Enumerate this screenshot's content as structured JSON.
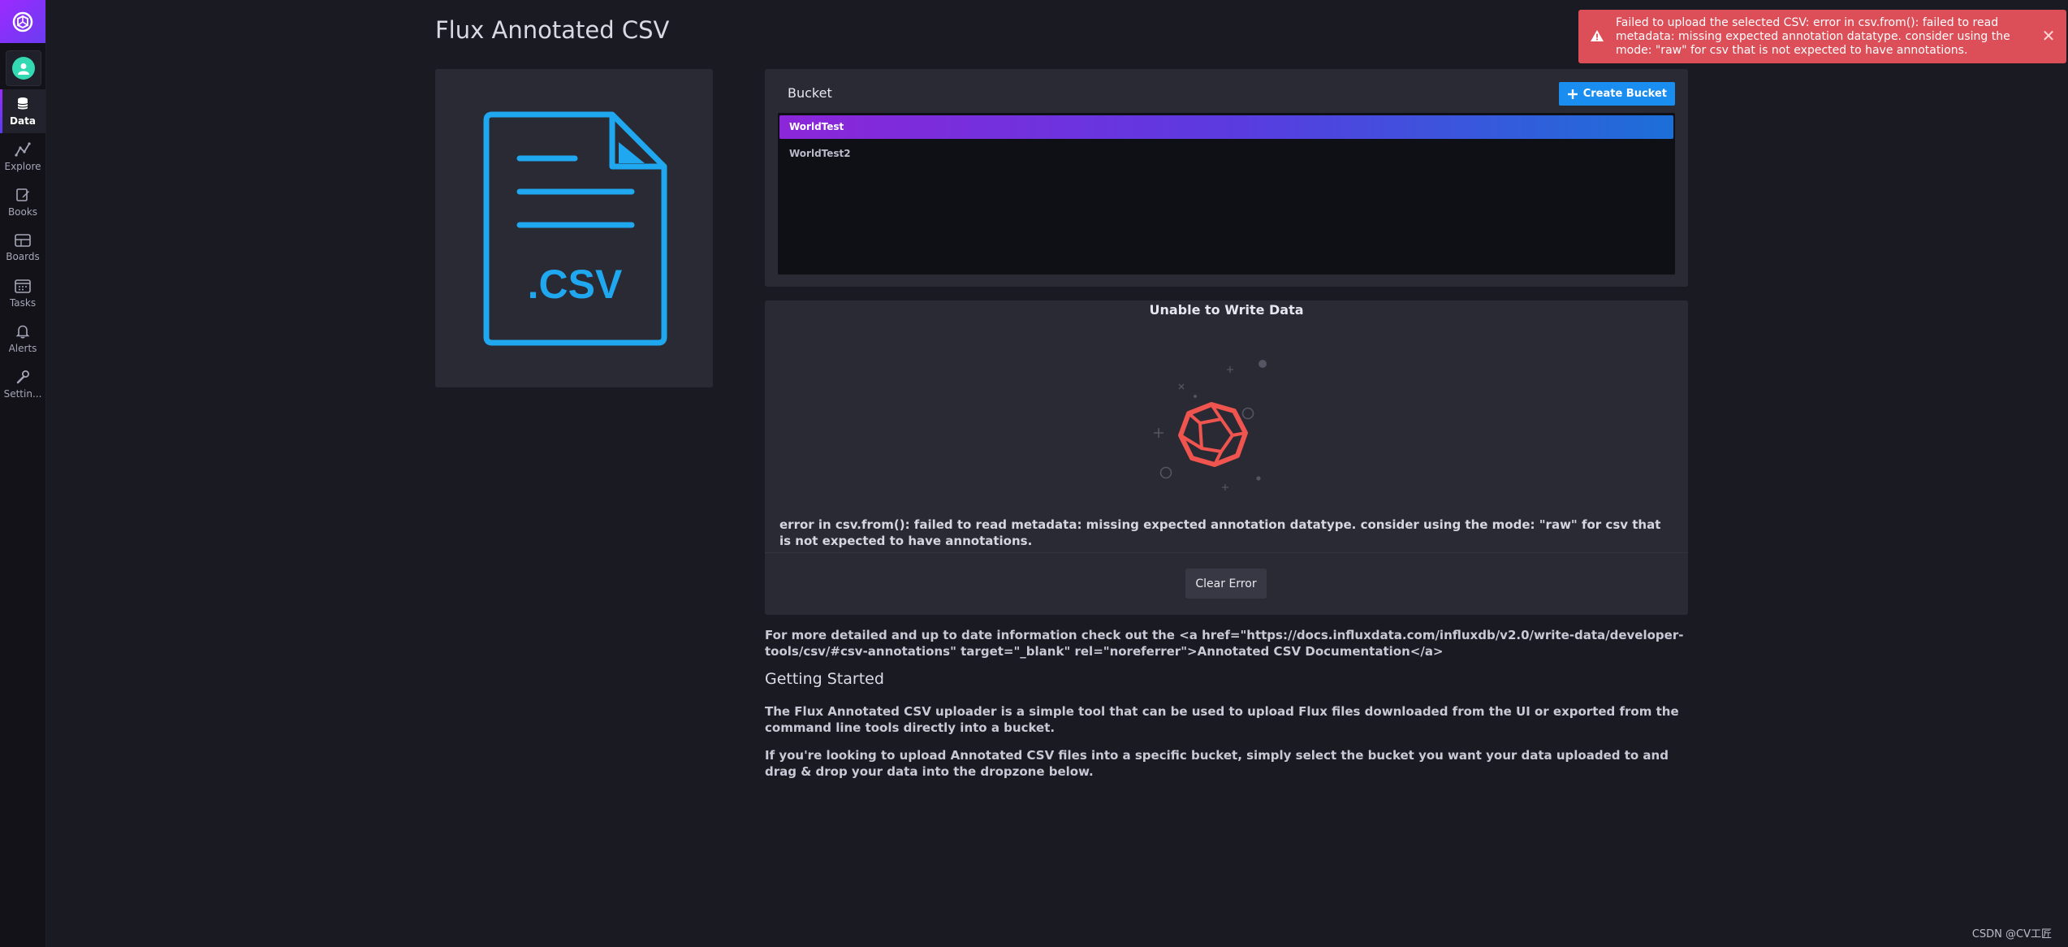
{
  "sidebar": {
    "logo_icon": "influxdb-logo-icon",
    "avatar_icon": "user-avatar-icon",
    "items": [
      {
        "label": "Data",
        "icon": "database-icon",
        "active": true
      },
      {
        "label": "Explore",
        "icon": "graph-icon",
        "active": false
      },
      {
        "label": "Books",
        "icon": "notebook-icon",
        "active": false
      },
      {
        "label": "Boards",
        "icon": "dashboard-icon",
        "active": false
      },
      {
        "label": "Tasks",
        "icon": "calendar-icon",
        "active": false
      },
      {
        "label": "Alerts",
        "icon": "bell-icon",
        "active": false
      },
      {
        "label": "Settin...",
        "icon": "wrench-icon",
        "active": false
      }
    ]
  },
  "page": {
    "title": "Flux Annotated CSV"
  },
  "csv_graphic": {
    "icon": "csv-file-icon",
    "extension": ".CSV",
    "color": "#1fa8f0"
  },
  "bucket": {
    "title": "Bucket",
    "create_label": "Create Bucket",
    "items": [
      {
        "name": "WorldTest",
        "selected": true
      },
      {
        "name": "WorldTest2",
        "selected": false
      }
    ]
  },
  "error": {
    "title": "Unable to Write Data",
    "icon": "error-dodecahedron-icon",
    "message": "error in csv.from(): failed to read metadata: missing expected annotation datatype. consider using the mode: \"raw\" for csv that is not expected to have annotations.",
    "clear_label": "Clear Error",
    "accent_color": "#f0544f"
  },
  "help": {
    "doc_text": "For more detailed and up to date information check out the <a href=\"https://docs.influxdata.com/influxdb/v2.0/write-data/developer-tools/csv/#csv-annotations\" target=\"_blank\" rel=\"noreferrer\">Annotated CSV Documentation</a>",
    "heading": "Getting Started",
    "paragraph1": "The Flux Annotated CSV uploader is a simple tool that can be used to upload Flux files downloaded from the UI or exported from the command line tools directly into a bucket.",
    "paragraph2": "If you're looking to upload Annotated CSV files into a specific bucket, simply select the bucket you want your data uploaded to and drag & drop your data into the dropzone below."
  },
  "toast": {
    "icon": "warning-triangle-icon",
    "message": "Failed to upload the selected CSV: error in csv.from(): failed to read metadata: missing expected annotation datatype. consider using the mode: \"raw\" for csv that is not expected to have annotations.",
    "close_icon": "close-icon",
    "close_glyph": "✕",
    "color": "#dc4e58"
  },
  "watermark": "CSDN @CV工匠"
}
